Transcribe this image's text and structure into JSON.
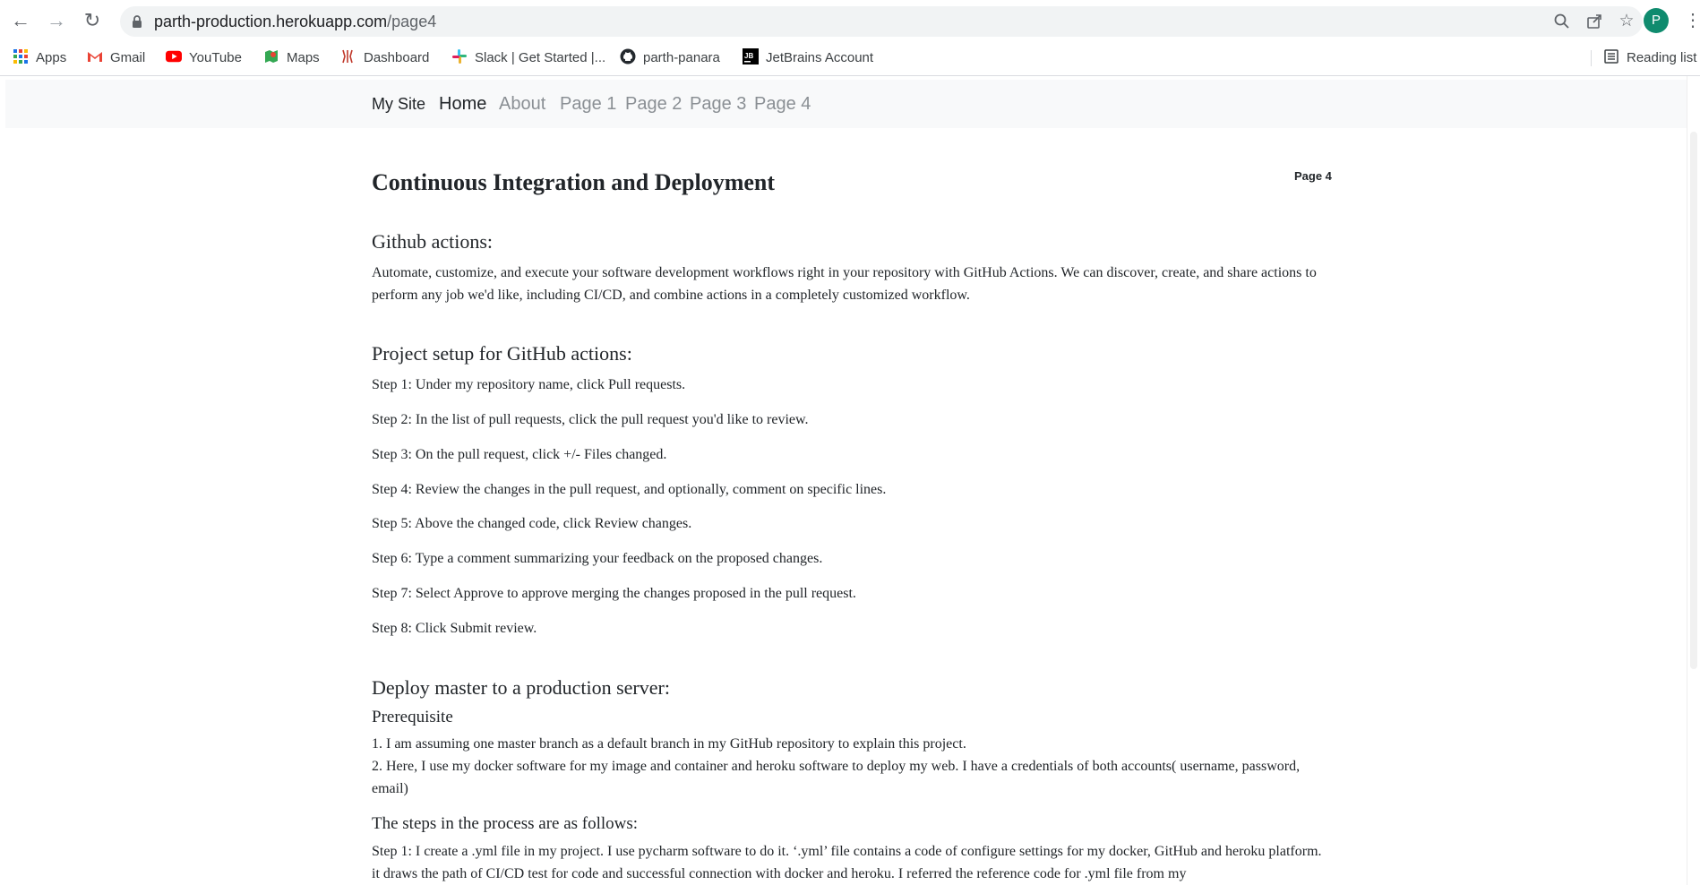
{
  "browser": {
    "url_host": "parth-production.herokuapp.com",
    "url_path": "/page4",
    "profile_initial": "P",
    "bookmarks": [
      {
        "label": "Apps",
        "icon": "apps-grid-icon"
      },
      {
        "label": "Gmail",
        "icon": "gmail-icon"
      },
      {
        "label": "YouTube",
        "icon": "youtube-icon"
      },
      {
        "label": "Maps",
        "icon": "maps-icon"
      },
      {
        "label": "Dashboard",
        "icon": "dashboard-icon"
      },
      {
        "label": "Slack | Get Started |...",
        "icon": "slack-icon"
      },
      {
        "label": "parth-panara",
        "icon": "github-icon"
      },
      {
        "label": "JetBrains Account",
        "icon": "jetbrains-icon"
      }
    ],
    "reading_list": "Reading list"
  },
  "site": {
    "brand": "My Site",
    "nav": [
      "Home",
      "About",
      "Page 1",
      "Page 2",
      "Page 3",
      "Page 4"
    ]
  },
  "article": {
    "title": "Continuous Integration and Deployment",
    "page_tag": "Page 4",
    "github_heading": "Github actions:",
    "github_text": "Automate, customize, and execute your software development workflows right in your repository with GitHub Actions. We can discover, create, and share actions to perform any job we'd like, including CI/CD, and combine actions in a completely customized workflow.",
    "setup_heading": "Project setup for GitHub actions:",
    "setup_steps": [
      "Step 1: Under my repository name, click Pull requests.",
      "Step 2: In the list of pull requests, click the pull request you'd like to review.",
      "Step 3: On the pull request, click +/- Files changed.",
      "Step 4: Review the changes in the pull request, and optionally, comment on specific lines.",
      "Step 5: Above the changed code, click Review changes.",
      "Step 6: Type a comment summarizing your feedback on the proposed changes.",
      "Step 7: Select Approve to approve merging the changes proposed in the pull request.",
      "Step 8: Click Submit review."
    ],
    "deploy_heading": "Deploy master to a production server:",
    "prereq_heading": "Prerequisite",
    "prereq_1": "1. I am assuming one master branch as a default branch in my GitHub repository to explain this project.",
    "prereq_2": "2. Here, I use my docker software for my image and container and heroku software to deploy my web. I have a credentials of both accounts( username, password, email)",
    "process_heading": "The steps in the process are as follows:",
    "process_step_1": "Step 1: I create a .yml file in my project. I use pycharm software to do it. ‘.yml’ file contains a code of configure settings for my docker, GitHub and heroku platform. it draws the path of CI/CD test for code and successful connection with docker and heroku. I referred the reference code for .yml file from my"
  }
}
